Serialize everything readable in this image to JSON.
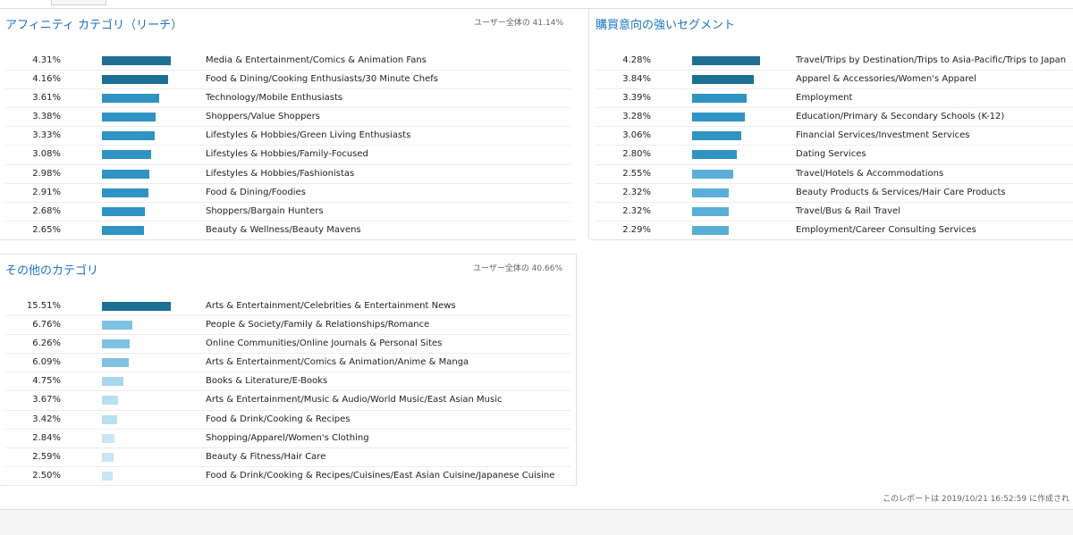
{
  "affinity": {
    "title": "アフィニティ カテゴリ（リーチ）",
    "meta": "ユーザー全体の 41.14%",
    "items": [
      {
        "pct": "4.31%",
        "value": 4.31,
        "label": "Media & Entertainment/Comics & Animation Fans",
        "color": "#1d6f93"
      },
      {
        "pct": "4.16%",
        "value": 4.16,
        "label": "Food & Dining/Cooking Enthusiasts/30 Minute Chefs",
        "color": "#1d6f93"
      },
      {
        "pct": "3.61%",
        "value": 3.61,
        "label": "Technology/Mobile Enthusiasts",
        "color": "#2f93c4"
      },
      {
        "pct": "3.38%",
        "value": 3.38,
        "label": "Shoppers/Value Shoppers",
        "color": "#2f93c4"
      },
      {
        "pct": "3.33%",
        "value": 3.33,
        "label": "Lifestyles & Hobbies/Green Living Enthusiasts",
        "color": "#2f93c4"
      },
      {
        "pct": "3.08%",
        "value": 3.08,
        "label": "Lifestyles & Hobbies/Family-Focused",
        "color": "#2f93c4"
      },
      {
        "pct": "2.98%",
        "value": 2.98,
        "label": "Lifestyles & Hobbies/Fashionistas",
        "color": "#2f93c4"
      },
      {
        "pct": "2.91%",
        "value": 2.91,
        "label": "Food & Dining/Foodies",
        "color": "#2f93c4"
      },
      {
        "pct": "2.68%",
        "value": 2.68,
        "label": "Shoppers/Bargain Hunters",
        "color": "#2f93c4"
      },
      {
        "pct": "2.65%",
        "value": 2.65,
        "label": "Beauty & Wellness/Beauty Mavens",
        "color": "#2f93c4"
      }
    ]
  },
  "inmarket": {
    "title": "購買意向の強いセグメント",
    "items": [
      {
        "pct": "4.28%",
        "value": 4.28,
        "label": "Travel/Trips by Destination/Trips to Asia-Pacific/Trips to Japan",
        "color": "#1d6f93"
      },
      {
        "pct": "3.84%",
        "value": 3.84,
        "label": "Apparel & Accessories/Women's Apparel",
        "color": "#1d6f93"
      },
      {
        "pct": "3.39%",
        "value": 3.39,
        "label": "Employment",
        "color": "#2f93c4"
      },
      {
        "pct": "3.28%",
        "value": 3.28,
        "label": "Education/Primary & Secondary Schools (K-12)",
        "color": "#2f93c4"
      },
      {
        "pct": "3.06%",
        "value": 3.06,
        "label": "Financial Services/Investment Services",
        "color": "#2f93c4"
      },
      {
        "pct": "2.80%",
        "value": 2.8,
        "label": "Dating Services",
        "color": "#2f93c4"
      },
      {
        "pct": "2.55%",
        "value": 2.55,
        "label": "Travel/Hotels & Accommodations",
        "color": "#5aafd8"
      },
      {
        "pct": "2.32%",
        "value": 2.32,
        "label": "Beauty Products & Services/Hair Care Products",
        "color": "#5aafd8"
      },
      {
        "pct": "2.32%",
        "value": 2.32,
        "label": "Travel/Bus & Rail Travel",
        "color": "#5aafd8"
      },
      {
        "pct": "2.29%",
        "value": 2.29,
        "label": "Employment/Career Consulting Services",
        "color": "#5aafd8"
      }
    ]
  },
  "other": {
    "title": "その他のカテゴリ",
    "meta": "ユーザー全体の 40.66%",
    "items": [
      {
        "pct": "15.51%",
        "value": 15.51,
        "label": "Arts & Entertainment/Celebrities & Entertainment News",
        "color": "#1d6f93"
      },
      {
        "pct": "6.76%",
        "value": 6.76,
        "label": "People & Society/Family & Relationships/Romance",
        "color": "#7fc2e3"
      },
      {
        "pct": "6.26%",
        "value": 6.26,
        "label": "Online Communities/Online Journals & Personal Sites",
        "color": "#7fc2e3"
      },
      {
        "pct": "6.09%",
        "value": 6.09,
        "label": "Arts & Entertainment/Comics & Animation/Anime & Manga",
        "color": "#7fc2e3"
      },
      {
        "pct": "4.75%",
        "value": 4.75,
        "label": "Books & Literature/E-Books",
        "color": "#a8d7ee"
      },
      {
        "pct": "3.67%",
        "value": 3.67,
        "label": "Arts & Entertainment/Music & Audio/World Music/East Asian Music",
        "color": "#b9dff1"
      },
      {
        "pct": "3.42%",
        "value": 3.42,
        "label": "Food & Drink/Cooking & Recipes",
        "color": "#b9dff1"
      },
      {
        "pct": "2.84%",
        "value": 2.84,
        "label": "Shopping/Apparel/Women's Clothing",
        "color": "#c8e6f4"
      },
      {
        "pct": "2.59%",
        "value": 2.59,
        "label": "Beauty & Fitness/Hair Care",
        "color": "#c8e6f4"
      },
      {
        "pct": "2.50%",
        "value": 2.5,
        "label": "Food & Drink/Cooking & Recipes/Cuisines/East Asian Cuisine/Japanese Cuisine",
        "color": "#c8e6f4"
      }
    ]
  },
  "footer": {
    "report_time": "このレポートは 2019/10/21 16:52:59 に作成され"
  }
}
